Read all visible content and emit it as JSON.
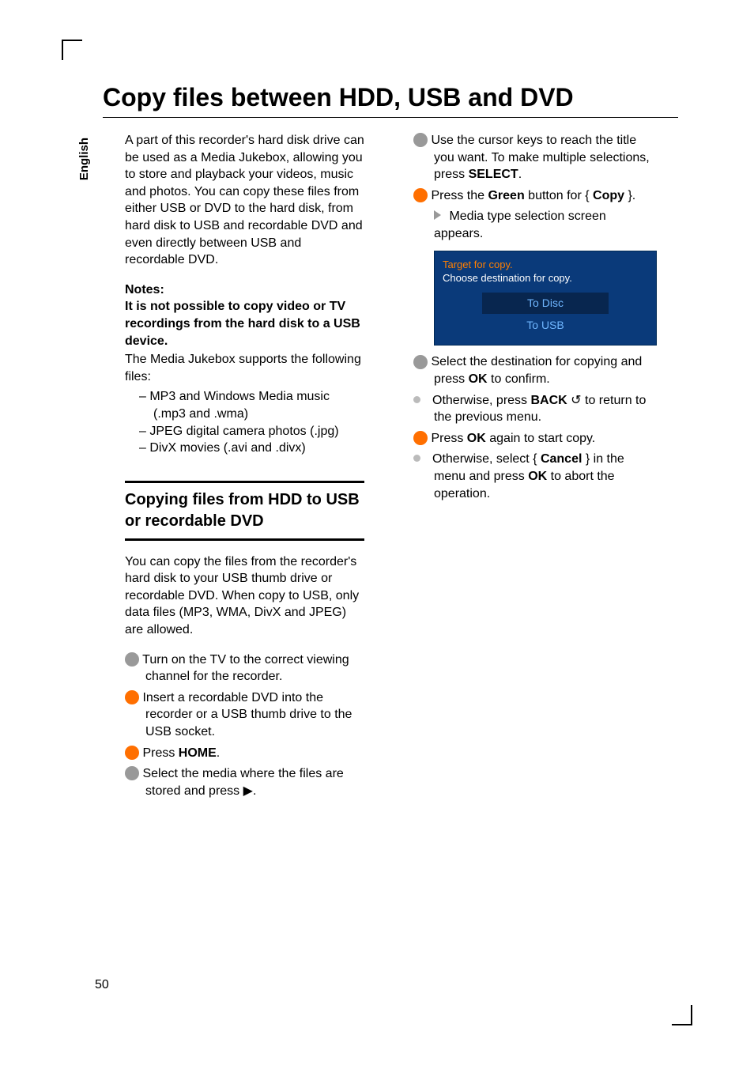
{
  "side_tab": "English",
  "title": "Copy files between HDD, USB and DVD",
  "left": {
    "intro": "A part of this recorder's hard disk drive can be used as a Media Jukebox, allowing you to store and playback your videos, music and photos.  You can copy these files from either USB or DVD to the hard disk, from hard disk to USB and recordable DVD and even directly between USB and recordable DVD.",
    "notes_label": "Notes:",
    "notes_bold": "It is not possible to copy video or TV recordings from the hard disk to a USB device.",
    "supports": "The Media Jukebox supports the following files:",
    "files": [
      "MP3 and Windows Media music (.mp3 and .wma)",
      "JPEG digital camera photos (.jpg)",
      "DivX movies (.avi and .divx)"
    ],
    "section_heading": "Copying files from HDD to USB or recordable DVD",
    "section_intro": "You can copy the files from the recorder's hard disk to your USB thumb drive or recordable DVD.  When copy to USB, only data files (MP3, WMA, DivX and JPEG) are allowed.",
    "step1": " Turn on the TV to the correct viewing channel for the recorder.",
    "step2": " Insert a recordable DVD into the recorder or a USB thumb drive to the USB socket.",
    "step3_pre": " Press ",
    "step3_b": "HOME",
    "step4_pre": " Select the media where the files are stored and press ",
    "step4_icon": "▶"
  },
  "right": {
    "step5_pre": " Use the cursor keys to reach the title you want.  To make multiple selections, press ",
    "step5_b": "SELECT",
    "step6_pre": " Press the ",
    "step6_b1": "Green",
    "step6_mid": " button for { ",
    "step6_b2": "Copy",
    "step6_post": " }.",
    "step6_res": " Media type selection screen appears.",
    "dialog": {
      "hdr1": "Target for copy.",
      "hdr2": "Choose destination for copy.",
      "opt1": "To Disc",
      "opt2": "To USB"
    },
    "step7_pre": " Select the destination for copying and press ",
    "step7_b": "OK",
    "step7_post": " to confirm.",
    "alt1_pre": "Otherwise, press ",
    "alt1_b": "BACK",
    "alt1_icon": " ↺",
    "alt1_post": " to return to the previous menu.",
    "step8_pre": " Press ",
    "step8_b": "OK",
    "step8_post": " again to start copy.",
    "alt2_pre": "Otherwise, select { ",
    "alt2_b1": "Cancel",
    "alt2_mid": " } in the menu and press ",
    "alt2_b2": "OK",
    "alt2_post": " to abort the operation."
  },
  "page_number": "50"
}
